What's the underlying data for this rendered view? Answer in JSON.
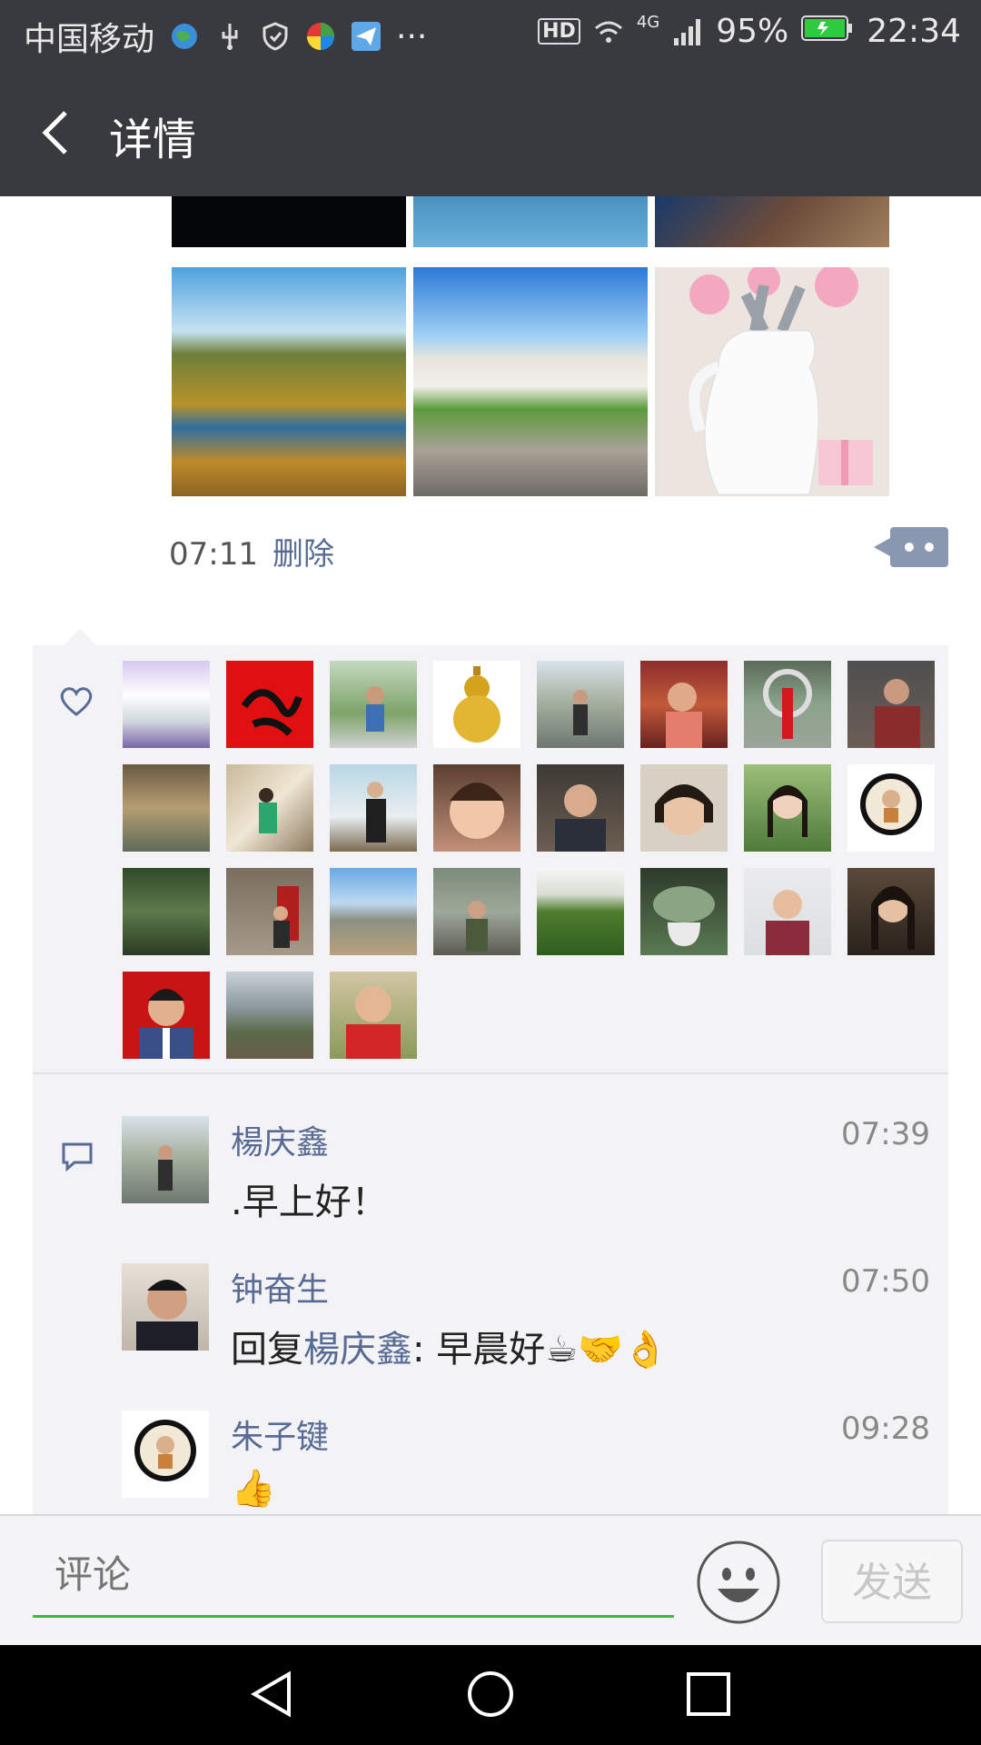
{
  "status_bar": {
    "carrier": "中国移动",
    "more": "···",
    "hd": "HD",
    "network": "4G",
    "battery": "95%",
    "time": "22:34"
  },
  "nav": {
    "title": "详情"
  },
  "post": {
    "time": "07:11",
    "delete_label": "删除"
  },
  "likes": {
    "count": 27
  },
  "comments": [
    {
      "name": "楊庆鑫",
      "time": "07:39",
      "text": ".早上好！"
    },
    {
      "name": "钟奋生",
      "time": "07:50",
      "reply_prefix": "回复",
      "reply_to": "楊庆鑫",
      "text": ": 早晨好☕🤝👌"
    },
    {
      "name": "朱子键",
      "time": "09:28",
      "text": "👍"
    }
  ],
  "comment_input": {
    "placeholder": "评论"
  },
  "send_label": "发送",
  "colors": {
    "link": "#576b95",
    "accent_green": "#3eb93e",
    "header": "#393a3f"
  }
}
